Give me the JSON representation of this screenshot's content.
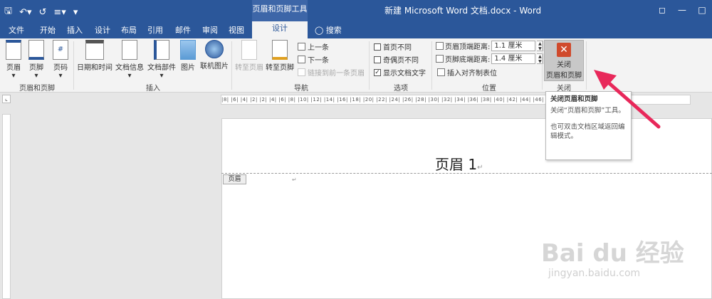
{
  "qat": {
    "save_icon": "save-icon",
    "undo_icon": "undo-icon",
    "redo_icon": "redo-icon",
    "customize": "▾"
  },
  "context_tab_title": "页眉和页脚工具",
  "window_title": "新建 Microsoft Word 文档.docx - Word",
  "tabs": [
    "文件",
    "开始",
    "插入",
    "设计",
    "布局",
    "引用",
    "邮件",
    "审阅",
    "视图"
  ],
  "active_tab": "设计",
  "tell_me": "搜索",
  "ribbon": {
    "header_footer": {
      "header": "页眉",
      "footer": "页脚",
      "page_number": "页码",
      "group": "页眉和页脚"
    },
    "insert": {
      "datetime": "日期和时间",
      "docinfo": "文档信息",
      "quickparts": "文档部件",
      "picture": "图片",
      "online_picture": "联机图片",
      "group": "插入"
    },
    "navigation": {
      "goto_header": "转至页眉",
      "goto_footer": "转至页脚",
      "prev": "上一条",
      "next": "下一条",
      "link_prev": "链接到前一条页眉",
      "group": "导航"
    },
    "options": {
      "diff_first": "首页不同",
      "diff_odd_even": "奇偶页不同",
      "show_text": "显示文档文字",
      "group": "选项"
    },
    "position": {
      "header_top_label": "页眉顶端距离:",
      "header_top_value": "1.1 厘米",
      "footer_bottom_label": "页脚底端距离:",
      "footer_bottom_value": "1.4 厘米",
      "insert_tab": "插入对齐制表位",
      "group": "位置"
    },
    "close": {
      "label1": "关闭",
      "label2": "页眉和页脚",
      "group": "关闭"
    }
  },
  "ruler_text": "|8|  |6|  |4|  |2|     |2|  |4|  |6|  |8|  |10|  |12|  |14|  |16|  |18|  |20|  |22|  |24|  |26|  |28|  |30|  |32|  |34|  |36|  |38|  |40|  |42|  |44|  |46|  |48",
  "document": {
    "header_text": "页眉 1",
    "header_tag": "页眉"
  },
  "tooltip": {
    "title": "关闭页眉和页脚",
    "body": "关闭“页眉和页脚”工具。",
    "body2": "也可双击文档区域返回编辑模式。"
  },
  "watermark": {
    "brand": "Bai du 经验",
    "url": "jingyan.baidu.com"
  },
  "colors": {
    "accent": "#2b579a",
    "arrow": "#e8285a",
    "close_icon": "#d04a2c"
  }
}
